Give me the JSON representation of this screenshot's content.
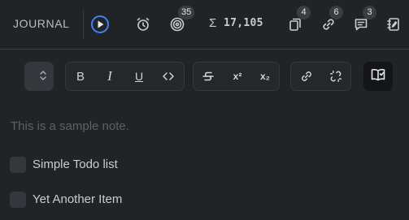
{
  "header": {
    "title": "JOURNAL",
    "play_icon": "play-circle-icon",
    "alarm_icon": "alarm-icon",
    "goal_icon": "target-icon",
    "goal_badge": "35",
    "word_count_symbol": "Σ",
    "word_count": "17,105",
    "pages_icon": "copy-icon",
    "pages_badge": "4",
    "links_icon": "link-icon",
    "links_badge": "6",
    "comments_icon": "comment-icon",
    "comments_badge": "3",
    "notes_icon": "notebook-icon",
    "accent_color": "#3b82f6"
  },
  "toolbar": {
    "text_type_select": "chevron-up-down-icon",
    "bold": "B",
    "italic": "I",
    "underline": "U",
    "code": "code-icon",
    "strikethrough": "strikethrough-icon",
    "superscript": "x²",
    "subscript": "x₂",
    "link": "link-icon",
    "unlink": "unlink-icon",
    "side_panel": "book-open-icon"
  },
  "editor": {
    "placeholder": "This is a sample note.",
    "todos": [
      {
        "label": "Simple Todo list",
        "checked": false
      },
      {
        "label": "Yet Another Item",
        "checked": false
      }
    ]
  }
}
